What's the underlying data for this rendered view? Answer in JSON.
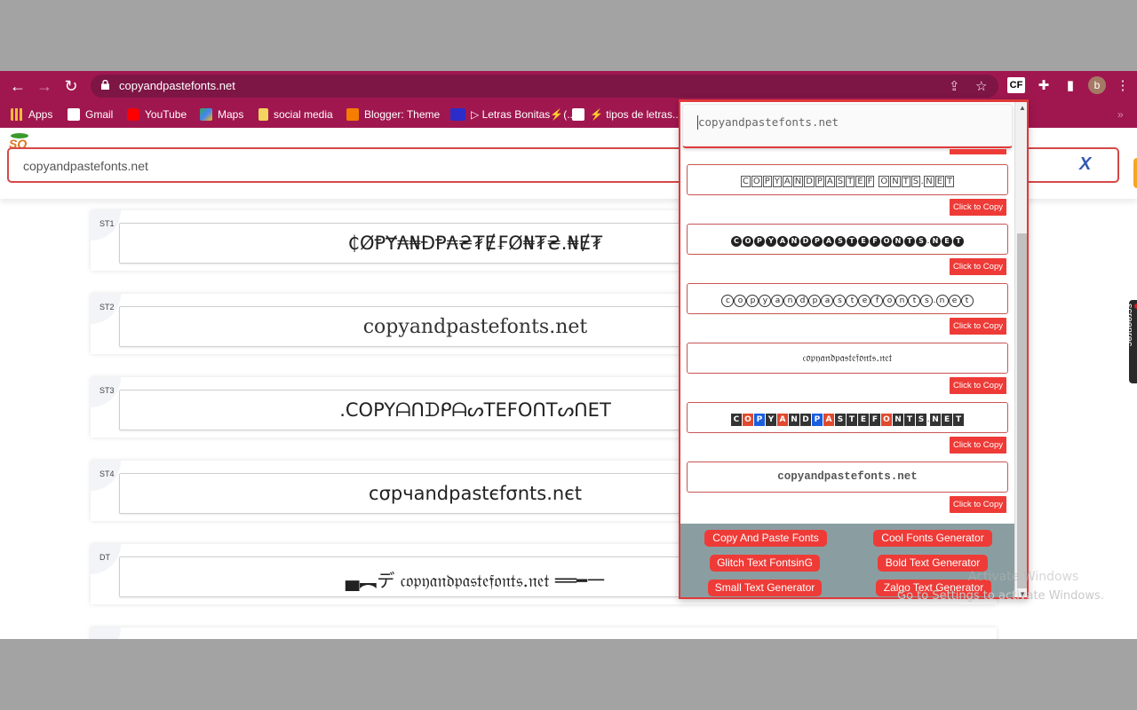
{
  "browser": {
    "url": "copyandpastefonts.net",
    "extension_label": "CF",
    "profile_initial": "b",
    "bookmarks": [
      {
        "label": "Apps",
        "icon": "apps-grid-icon",
        "color": "#f1b93a"
      },
      {
        "label": "Gmail",
        "icon": "gmail-icon",
        "color": "#ffffff"
      },
      {
        "label": "YouTube",
        "icon": "youtube-icon",
        "color": "#ff0000"
      },
      {
        "label": "Maps",
        "icon": "maps-icon",
        "color": "#34a853"
      },
      {
        "label": "social media",
        "icon": "folder-icon",
        "color": "#f4d35e"
      },
      {
        "label": "Blogger: Theme",
        "icon": "blogger-icon",
        "color": "#f57d00"
      },
      {
        "label": "▷ Letras Bonitas⚡(...",
        "icon": "lb-icon",
        "color": "#2c2cc9"
      },
      {
        "label": "⚡ tipos de letras...",
        "icon": "td-icon",
        "color": "#ffffff"
      }
    ],
    "overflow_label": "»"
  },
  "page": {
    "search_value": "copyandpastefonts.net",
    "clear_label": "X",
    "styles": [
      {
        "tag": "ST1",
        "text": "₵ØⱣɎ₳₦ĐⱣ₳₴₮Ɇ₣Ø₦₮₴.₦Ɇ₮"
      },
      {
        "tag": "ST2",
        "text": "copyandpastefonts.net"
      },
      {
        "tag": "ST3",
        "text": ".COPYᗩᑎᗪᑭᗩᔕTEFOᑎTᔕᑎET"
      },
      {
        "tag": "ST4",
        "text": "cσpчandpastєfσnts.nєt"
      },
      {
        "tag": "DT",
        "text": "▄︻デ 𝔠𝔬𝔭𝔶𝔞𝔫𝔡𝔭𝔞𝔰𝔱𝔢𝔣𝔬𝔫𝔱𝔰.𝔫𝔢𝔱 ══━一"
      }
    ]
  },
  "popup": {
    "input_value": "copyandpastefonts.net",
    "copy_label": "Click to Copy",
    "results": [
      {
        "style": "squared",
        "text": "COPYANDPASTEF ONTS.NET"
      },
      {
        "style": "circled-black",
        "text": "COPYANDPASTEFONTS.NET"
      },
      {
        "style": "circled-white",
        "text": "copyandpastefonts.net"
      },
      {
        "style": "fraktur",
        "text": "𝔠𝔬𝔭𝔶𝔞𝔫𝔡𝔭𝔞𝔰𝔱𝔢𝔣𝔬𝔫𝔱𝔰.𝔫𝔢𝔱"
      },
      {
        "style": "tiles",
        "text": "COPYANDPASTEFONTS.NET"
      },
      {
        "style": "serif-bold",
        "text": "copyandpastefonts.net"
      }
    ],
    "tile_colors": {
      "dark": "#333333",
      "red": "#e04a2f",
      "blue": "#1a5ee0"
    },
    "footer_links": [
      "Copy And Paste Fonts",
      "Cool Fonts Generator",
      "Glitch Text FontsinG",
      "Bold Text Generator",
      "Small Text Generator",
      "Zalgo Text Generator"
    ]
  },
  "overlays": {
    "screenrec_label": "screenrec",
    "activate_title": "Activate Windows",
    "activate_sub": "Go to Settings to activate Windows."
  },
  "colors": {
    "chrome": "#a0174f",
    "accent_red": "#ee3b37",
    "footer_bg": "#8a9ea1"
  }
}
